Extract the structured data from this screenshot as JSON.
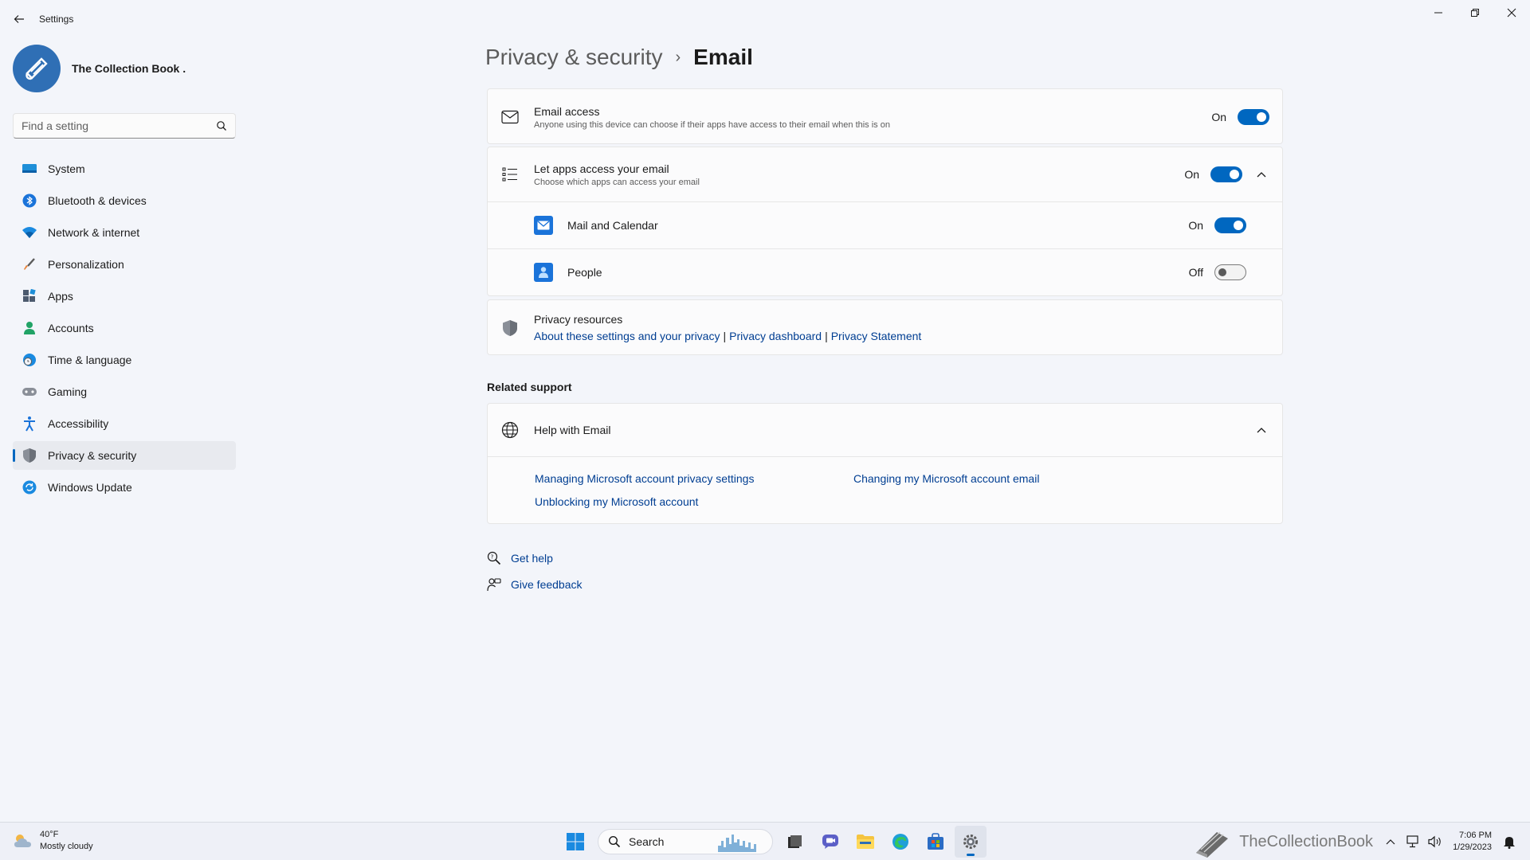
{
  "window": {
    "title": "Settings"
  },
  "profile": {
    "name": "The Collection Book ."
  },
  "search": {
    "placeholder": "Find a setting"
  },
  "sidebar": {
    "items": [
      {
        "label": "System",
        "icon": "monitor-icon"
      },
      {
        "label": "Bluetooth & devices",
        "icon": "bluetooth-icon"
      },
      {
        "label": "Network & internet",
        "icon": "wifi-icon"
      },
      {
        "label": "Personalization",
        "icon": "brush-icon"
      },
      {
        "label": "Apps",
        "icon": "apps-icon"
      },
      {
        "label": "Accounts",
        "icon": "person-icon"
      },
      {
        "label": "Time & language",
        "icon": "clock-globe-icon"
      },
      {
        "label": "Gaming",
        "icon": "gamepad-icon"
      },
      {
        "label": "Accessibility",
        "icon": "accessibility-icon"
      },
      {
        "label": "Privacy & security",
        "icon": "shield-icon",
        "active": true
      },
      {
        "label": "Windows Update",
        "icon": "update-icon"
      }
    ]
  },
  "breadcrumb": {
    "parent": "Privacy & security",
    "separator": "›",
    "current": "Email"
  },
  "email_access": {
    "title": "Email access",
    "subtitle": "Anyone using this device can choose if their apps have access to their email when this is on",
    "state": "On"
  },
  "let_apps": {
    "title": "Let apps access your email",
    "subtitle": "Choose which apps can access your email",
    "state": "On",
    "apps": [
      {
        "name": "Mail and Calendar",
        "state": "On",
        "icon": "mail-app-icon"
      },
      {
        "name": "People",
        "state": "Off",
        "icon": "people-app-icon"
      }
    ]
  },
  "privacy_resources": {
    "title": "Privacy resources",
    "links": [
      "About these settings and your privacy",
      "Privacy dashboard",
      "Privacy Statement"
    ],
    "separator": "|"
  },
  "related_support": {
    "label": "Related support",
    "help_title": "Help with Email",
    "links": [
      "Managing Microsoft account privacy settings",
      "Changing my Microsoft account email",
      "Unblocking my Microsoft account"
    ]
  },
  "footer": {
    "get_help": "Get help",
    "give_feedback": "Give feedback"
  },
  "taskbar": {
    "weather_temp": "40°F",
    "weather_desc": "Mostly cloudy",
    "search_label": "Search",
    "time": "7:06 PM",
    "date": "1/29/2023",
    "watermark": "TheCollectionBook"
  },
  "colors": {
    "accent": "#0067c0",
    "link": "#003e92",
    "background": "#f3f5fa"
  }
}
